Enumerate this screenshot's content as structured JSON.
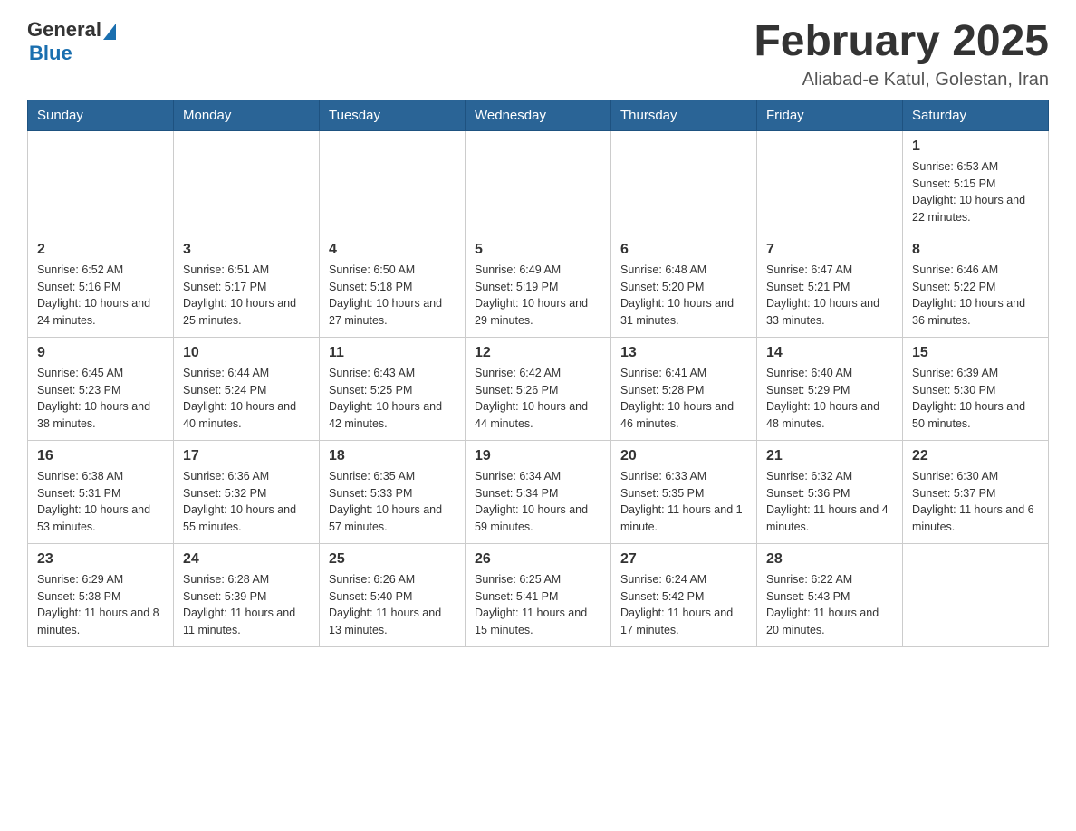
{
  "logo": {
    "general": "General",
    "blue": "Blue"
  },
  "header": {
    "title": "February 2025",
    "location": "Aliabad-e Katul, Golestan, Iran"
  },
  "days_of_week": [
    "Sunday",
    "Monday",
    "Tuesday",
    "Wednesday",
    "Thursday",
    "Friday",
    "Saturday"
  ],
  "weeks": [
    [
      {
        "day": "",
        "info": ""
      },
      {
        "day": "",
        "info": ""
      },
      {
        "day": "",
        "info": ""
      },
      {
        "day": "",
        "info": ""
      },
      {
        "day": "",
        "info": ""
      },
      {
        "day": "",
        "info": ""
      },
      {
        "day": "1",
        "info": "Sunrise: 6:53 AM\nSunset: 5:15 PM\nDaylight: 10 hours and 22 minutes."
      }
    ],
    [
      {
        "day": "2",
        "info": "Sunrise: 6:52 AM\nSunset: 5:16 PM\nDaylight: 10 hours and 24 minutes."
      },
      {
        "day": "3",
        "info": "Sunrise: 6:51 AM\nSunset: 5:17 PM\nDaylight: 10 hours and 25 minutes."
      },
      {
        "day": "4",
        "info": "Sunrise: 6:50 AM\nSunset: 5:18 PM\nDaylight: 10 hours and 27 minutes."
      },
      {
        "day": "5",
        "info": "Sunrise: 6:49 AM\nSunset: 5:19 PM\nDaylight: 10 hours and 29 minutes."
      },
      {
        "day": "6",
        "info": "Sunrise: 6:48 AM\nSunset: 5:20 PM\nDaylight: 10 hours and 31 minutes."
      },
      {
        "day": "7",
        "info": "Sunrise: 6:47 AM\nSunset: 5:21 PM\nDaylight: 10 hours and 33 minutes."
      },
      {
        "day": "8",
        "info": "Sunrise: 6:46 AM\nSunset: 5:22 PM\nDaylight: 10 hours and 36 minutes."
      }
    ],
    [
      {
        "day": "9",
        "info": "Sunrise: 6:45 AM\nSunset: 5:23 PM\nDaylight: 10 hours and 38 minutes."
      },
      {
        "day": "10",
        "info": "Sunrise: 6:44 AM\nSunset: 5:24 PM\nDaylight: 10 hours and 40 minutes."
      },
      {
        "day": "11",
        "info": "Sunrise: 6:43 AM\nSunset: 5:25 PM\nDaylight: 10 hours and 42 minutes."
      },
      {
        "day": "12",
        "info": "Sunrise: 6:42 AM\nSunset: 5:26 PM\nDaylight: 10 hours and 44 minutes."
      },
      {
        "day": "13",
        "info": "Sunrise: 6:41 AM\nSunset: 5:28 PM\nDaylight: 10 hours and 46 minutes."
      },
      {
        "day": "14",
        "info": "Sunrise: 6:40 AM\nSunset: 5:29 PM\nDaylight: 10 hours and 48 minutes."
      },
      {
        "day": "15",
        "info": "Sunrise: 6:39 AM\nSunset: 5:30 PM\nDaylight: 10 hours and 50 minutes."
      }
    ],
    [
      {
        "day": "16",
        "info": "Sunrise: 6:38 AM\nSunset: 5:31 PM\nDaylight: 10 hours and 53 minutes."
      },
      {
        "day": "17",
        "info": "Sunrise: 6:36 AM\nSunset: 5:32 PM\nDaylight: 10 hours and 55 minutes."
      },
      {
        "day": "18",
        "info": "Sunrise: 6:35 AM\nSunset: 5:33 PM\nDaylight: 10 hours and 57 minutes."
      },
      {
        "day": "19",
        "info": "Sunrise: 6:34 AM\nSunset: 5:34 PM\nDaylight: 10 hours and 59 minutes."
      },
      {
        "day": "20",
        "info": "Sunrise: 6:33 AM\nSunset: 5:35 PM\nDaylight: 11 hours and 1 minute."
      },
      {
        "day": "21",
        "info": "Sunrise: 6:32 AM\nSunset: 5:36 PM\nDaylight: 11 hours and 4 minutes."
      },
      {
        "day": "22",
        "info": "Sunrise: 6:30 AM\nSunset: 5:37 PM\nDaylight: 11 hours and 6 minutes."
      }
    ],
    [
      {
        "day": "23",
        "info": "Sunrise: 6:29 AM\nSunset: 5:38 PM\nDaylight: 11 hours and 8 minutes."
      },
      {
        "day": "24",
        "info": "Sunrise: 6:28 AM\nSunset: 5:39 PM\nDaylight: 11 hours and 11 minutes."
      },
      {
        "day": "25",
        "info": "Sunrise: 6:26 AM\nSunset: 5:40 PM\nDaylight: 11 hours and 13 minutes."
      },
      {
        "day": "26",
        "info": "Sunrise: 6:25 AM\nSunset: 5:41 PM\nDaylight: 11 hours and 15 minutes."
      },
      {
        "day": "27",
        "info": "Sunrise: 6:24 AM\nSunset: 5:42 PM\nDaylight: 11 hours and 17 minutes."
      },
      {
        "day": "28",
        "info": "Sunrise: 6:22 AM\nSunset: 5:43 PM\nDaylight: 11 hours and 20 minutes."
      },
      {
        "day": "",
        "info": ""
      }
    ]
  ]
}
